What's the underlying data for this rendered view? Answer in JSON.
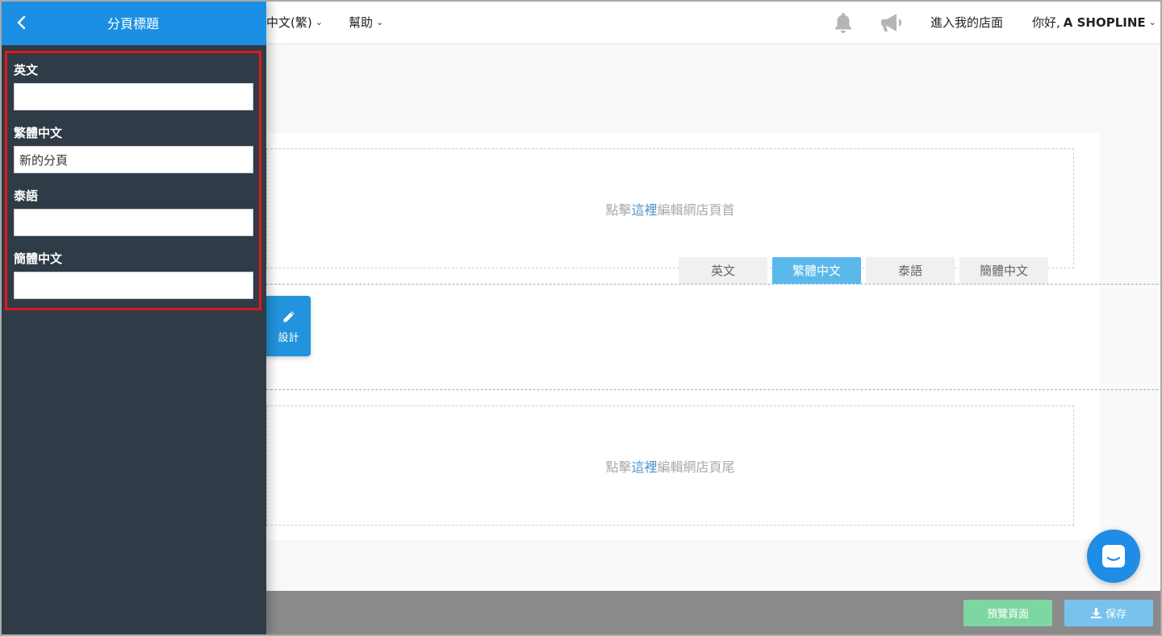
{
  "topnav": {
    "language": "中文(繁)",
    "help": "幫助",
    "enter_store": "進入我的店面",
    "greeting": "你好,",
    "user_name": "A SHOPLINE"
  },
  "canvas": {
    "header_prefix": "點擊",
    "header_link": "這裡",
    "header_suffix": "編輯網店頁首",
    "footer_prefix": "點擊",
    "footer_link": "這裡",
    "footer_suffix": "編輯網店頁尾"
  },
  "lang_tabs": [
    {
      "label": "英文",
      "active": false
    },
    {
      "label": "繁體中文",
      "active": true
    },
    {
      "label": "泰語",
      "active": false
    },
    {
      "label": "簡體中文",
      "active": false
    }
  ],
  "design_button": {
    "label": "設計"
  },
  "bottom_bar": {
    "preview": "預覽頁面",
    "save": "保存"
  },
  "sidebar": {
    "title": "分頁標題",
    "fields": [
      {
        "label": "英文",
        "value": ""
      },
      {
        "label": "繁體中文",
        "value": "新的分頁"
      },
      {
        "label": "泰語",
        "value": ""
      },
      {
        "label": "簡體中文",
        "value": ""
      }
    ]
  },
  "colors": {
    "accent_blue": "#1a8fe3",
    "sidebar_bg": "#2f3b47",
    "highlight_border": "#e0191b",
    "active_tab": "#5bb8ea",
    "preview_button": "#7ed6a3",
    "save_button": "#78c3ee"
  },
  "icons": [
    "chevron-left-icon",
    "bell-icon",
    "megaphone-icon",
    "pencil-icon",
    "download-icon",
    "chat-icon"
  ]
}
